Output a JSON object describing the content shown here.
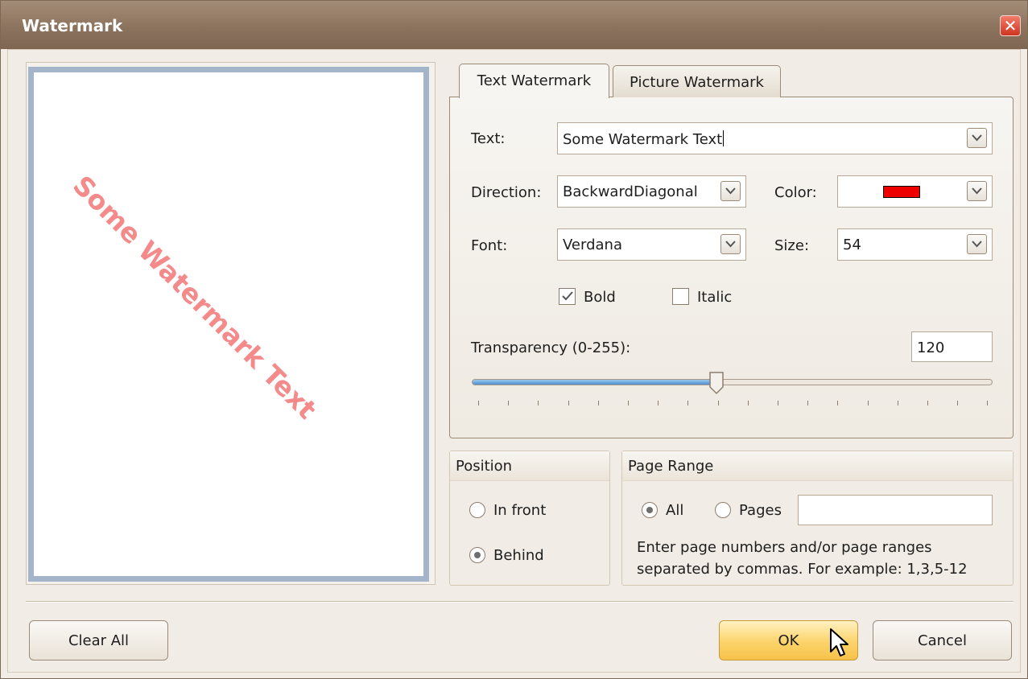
{
  "window": {
    "title": "Watermark",
    "close_symbol": "✕"
  },
  "preview": {
    "watermark_text": "Some Watermark Text",
    "watermark_color": "#f48a8a"
  },
  "tabs": [
    {
      "label": "Text Watermark",
      "active": true
    },
    {
      "label": "Picture Watermark",
      "active": false
    }
  ],
  "form": {
    "text_label": "Text:",
    "text_value": "Some Watermark Text",
    "direction_label": "Direction:",
    "direction_value": "BackwardDiagonal",
    "color_label": "Color:",
    "color_value": "#ee0000",
    "font_label": "Font:",
    "font_value": "Verdana",
    "size_label": "Size:",
    "size_value": "54",
    "bold_label": "Bold",
    "bold_checked": true,
    "italic_label": "Italic",
    "italic_checked": false,
    "transparency_label": "Transparency (0-255):",
    "transparency_value": "120",
    "slider_value": 120,
    "slider_max": 255
  },
  "position": {
    "title": "Position",
    "options": [
      {
        "label": "In front",
        "selected": false
      },
      {
        "label": "Behind",
        "selected": true
      }
    ]
  },
  "page_range": {
    "title": "Page Range",
    "all_label": "All",
    "all_selected": true,
    "pages_label": "Pages",
    "pages_selected": false,
    "pages_value": "",
    "hint_line1": "Enter page numbers and/or page ranges",
    "hint_line2": "separated by commas. For example: 1,3,5-12"
  },
  "buttons": {
    "clear_all": "Clear All",
    "ok": "OK",
    "cancel": "Cancel"
  }
}
